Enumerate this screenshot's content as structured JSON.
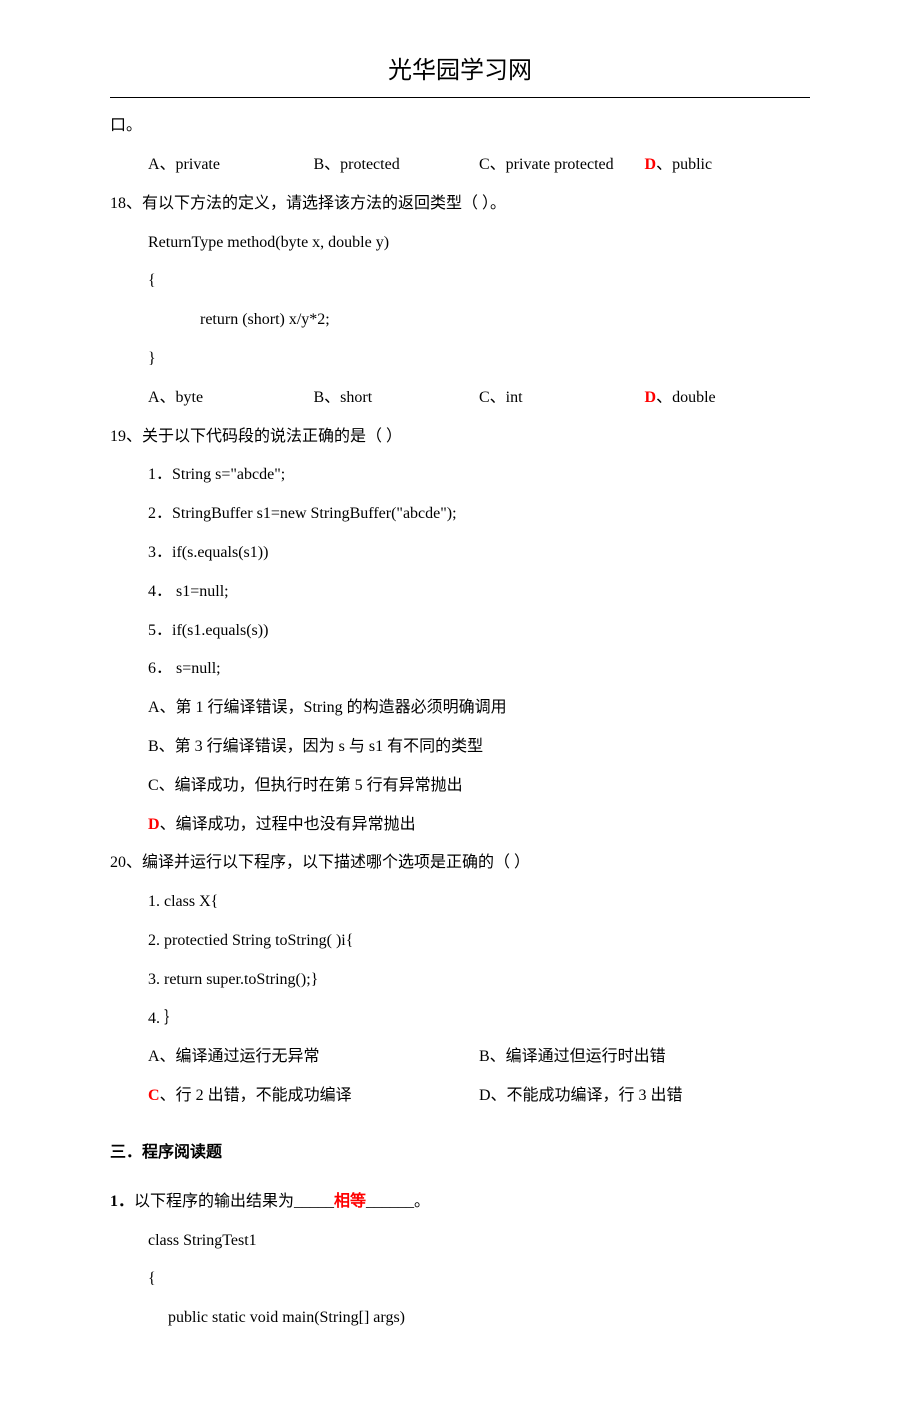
{
  "header": {
    "title": "光华园学习网"
  },
  "fragment": {
    "end": "口。"
  },
  "q17_options": {
    "a": "A、private",
    "b": "B、protected",
    "c": "C、private  protected",
    "d_label": "D",
    "d_text": "、public"
  },
  "q18": {
    "prompt": "18、有以下方法的定义，请选择该方法的返回类型（      ）。",
    "code": [
      "ReturnType   method(byte x, double y)",
      "{",
      "return (short) x/y*2;",
      "}"
    ],
    "options": {
      "a": "A、byte",
      "b": "B、short",
      "c": "C、int",
      "d_label": "D",
      "d_text": "、double"
    }
  },
  "q19": {
    "prompt": "19、关于以下代码段的说法正确的是（                ）",
    "code": [
      "1．String   s=\"abcde\";",
      "2．StringBuffer   s1=new   StringBuffer(\"abcde\");",
      "3．if(s.equals(s1))",
      "4．          s1=null;",
      "5．if(s1.equals(s))",
      "6．          s=null;"
    ],
    "options": {
      "a": "A、第 1 行编译错误，String 的构造器必须明确调用",
      "b": "B、第 3 行编译错误，因为 s 与 s1 有不同的类型",
      "c": "C、编译成功，但执行时在第 5 行有异常抛出",
      "d_label": "D",
      "d_text": "、编译成功，过程中也没有异常抛出"
    }
  },
  "q20": {
    "prompt": "20、编译并运行以下程序，以下描述哪个选项是正确的（              ）",
    "code": [
      "1. class   X{",
      "2.  protectied   String   toString( )i{",
      "3.       return   super.toString();}",
      "4. ｝"
    ],
    "options": {
      "a": "A、编译通过运行无异常",
      "b": "B、编译通过但运行时出错",
      "c_label": "C",
      "c_text": "、行 2 出错，不能成功编译",
      "d": "D、不能成功编译，行 3 出错"
    }
  },
  "section3": {
    "title": "三．程序阅读题"
  },
  "p1": {
    "num": "1．",
    "prefix": "以下程序的输出结果为_____",
    "answer": "相等",
    "suffix": "______。",
    "code": [
      "class StringTest1",
      "{",
      "public static void main(String[] args)"
    ]
  }
}
